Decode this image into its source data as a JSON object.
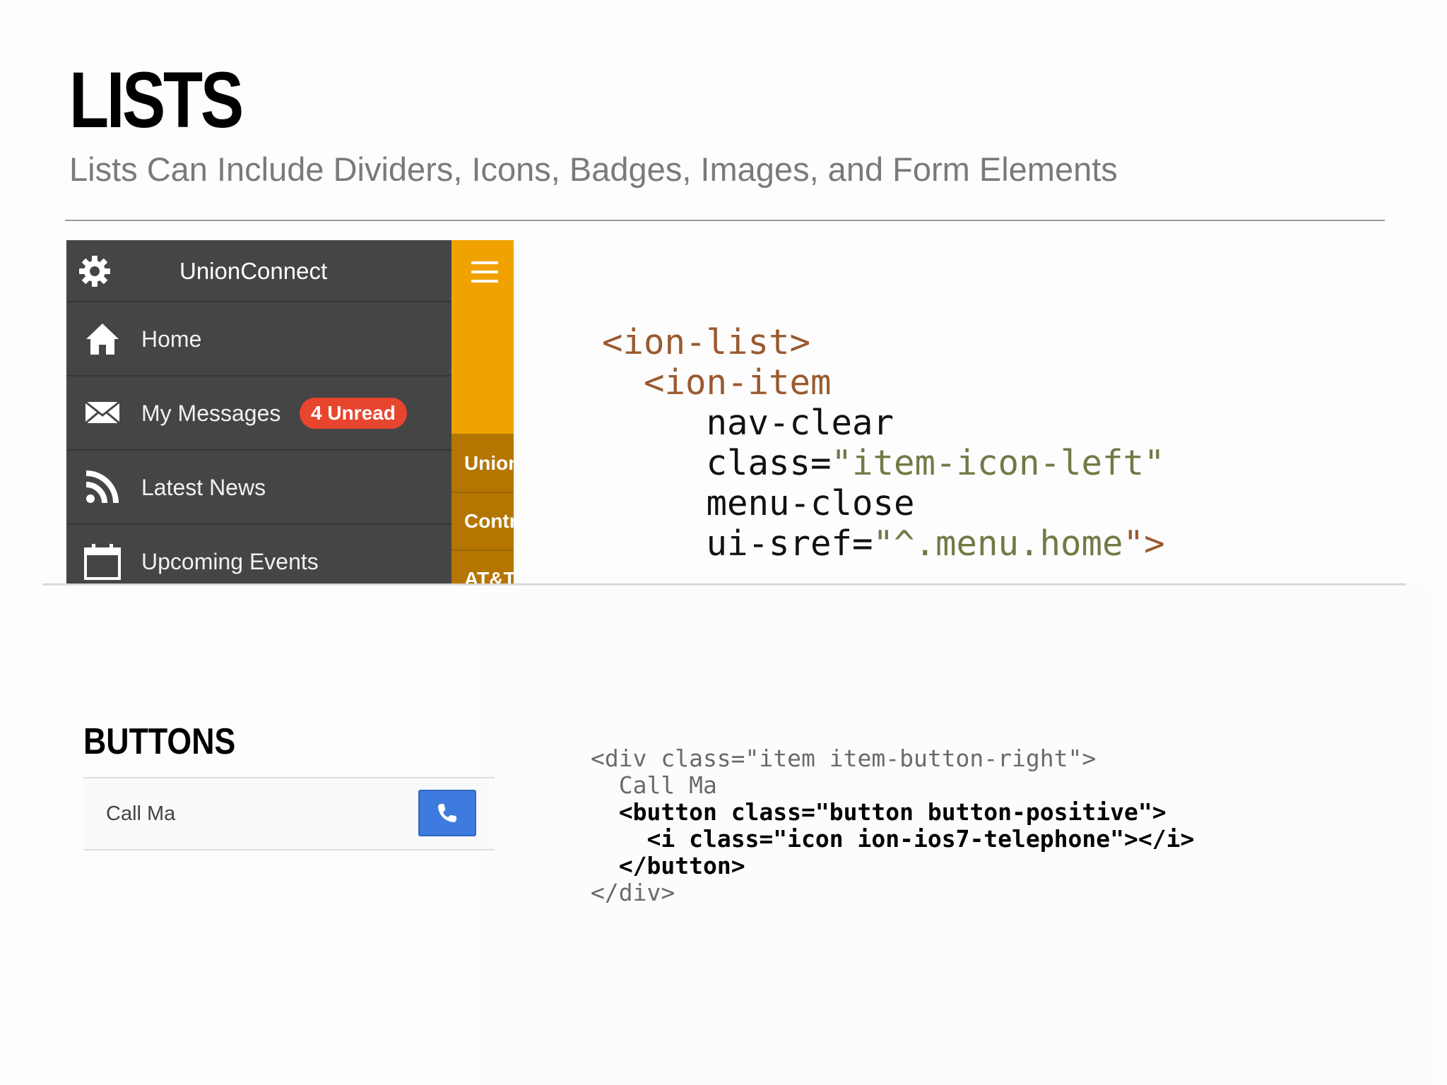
{
  "slide": {
    "title": "LISTS",
    "subtitle": "Lists Can Include Dividers, Icons, Badges, Images, and Form Elements"
  },
  "app": {
    "title": "UnionConnect",
    "menu": [
      {
        "label": "Home",
        "icon": "home-icon"
      },
      {
        "label": "My Messages",
        "icon": "envelope-icon",
        "badge": "4 Unread"
      },
      {
        "label": "Latest News",
        "icon": "rss-icon"
      },
      {
        "label": "Upcoming Events",
        "icon": "calendar-icon"
      }
    ],
    "side_items": [
      "Union",
      "Contr",
      "AT&T"
    ]
  },
  "code_large": {
    "l1": "<ion-list>",
    "l2": "<ion-item",
    "l3": "nav-clear",
    "l4_attr": "class=",
    "l4_val": "\"item-icon-left\"",
    "l5": "menu-close",
    "l6_attr": "ui-sref=",
    "l6_q1": "\"^",
    "l6_val": ".menu.home",
    "l6_q2": "\">"
  },
  "buttons_section": {
    "title": "BUTTONS",
    "item_label": "Call Ma",
    "button_icon": "telephone-icon"
  },
  "code_small": {
    "l1": "<div class=\"item item-button-right\">",
    "l2": "Call Ma",
    "l3": "<button class=\"button button-positive\">",
    "l4": "<i class=\"icon ion-ios7-telephone\"></i>",
    "l5": "</button>",
    "l6": "</div>"
  },
  "colors": {
    "menu_bg": "#454545",
    "accent_orange": "#f0a200",
    "badge_red": "#e8452f",
    "button_blue": "#3d7bde",
    "code_tag": "#9a5a2f",
    "code_string": "#6f7b46"
  }
}
